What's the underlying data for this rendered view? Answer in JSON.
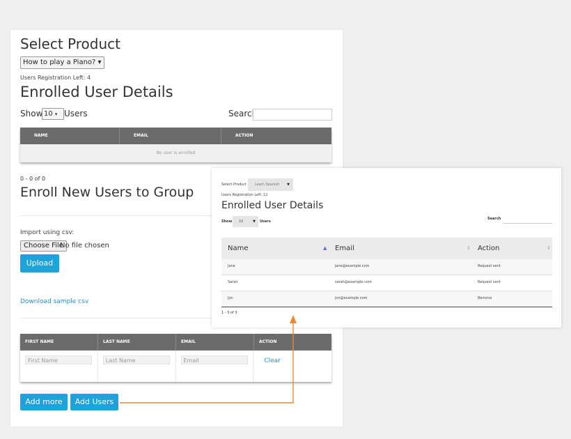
{
  "main": {
    "select_product_title": "Select Product",
    "product_selected": "How to play a Piano?",
    "users_registration_left": "Users Registration Left: 4",
    "enrolled_title": "Enrolled User Details",
    "show_label": "Show",
    "show_value": "10",
    "users_label": "Users",
    "search_label": "Search",
    "table_headers": [
      "NAME",
      "EMAIL",
      "ACTION"
    ],
    "empty_message": "No user is enrolled",
    "pagination": "0 - 0 of 0",
    "enroll_title": "Enroll New Users to Group",
    "import_label": "Import using csv:",
    "choose_file_label": "Choose File",
    "no_file_text": "No file chosen",
    "upload_label": "Upload",
    "download_link": "Download sample csv",
    "add_headers": [
      "FIRST NAME",
      "LAST NAME",
      "EMAIL",
      "ACTION"
    ],
    "placeholders": {
      "first": "First Name",
      "last": "Last Name",
      "email": "Email"
    },
    "clear_label": "Clear",
    "add_more_label": "Add more",
    "add_users_label": "Add Users"
  },
  "secondary": {
    "select_product_label": "Select Product",
    "product_selected": "Learn Spanish",
    "users_registration_left": "Users Registration Left: 12",
    "enrolled_title": "Enrolled User Details",
    "show_label": "Show",
    "show_value": "10",
    "users_label": "Users",
    "search_label": "Search",
    "headers": [
      "Name",
      "Email",
      "Action"
    ],
    "rows": [
      {
        "name": "Jane",
        "email": "jane@example.com",
        "action": "Request sent"
      },
      {
        "name": "Sarah",
        "email": "sarah@example.com",
        "action": "Request sent"
      },
      {
        "name": "Jon",
        "email": "jon@example.com",
        "action": "Remove"
      }
    ],
    "pagination": "1 - 3 of 3"
  },
  "colors": {
    "accent": "#1ea2d9",
    "arrow": "#f0862e",
    "table_header": "#6b6b6b",
    "link": "#2a8fc7"
  }
}
